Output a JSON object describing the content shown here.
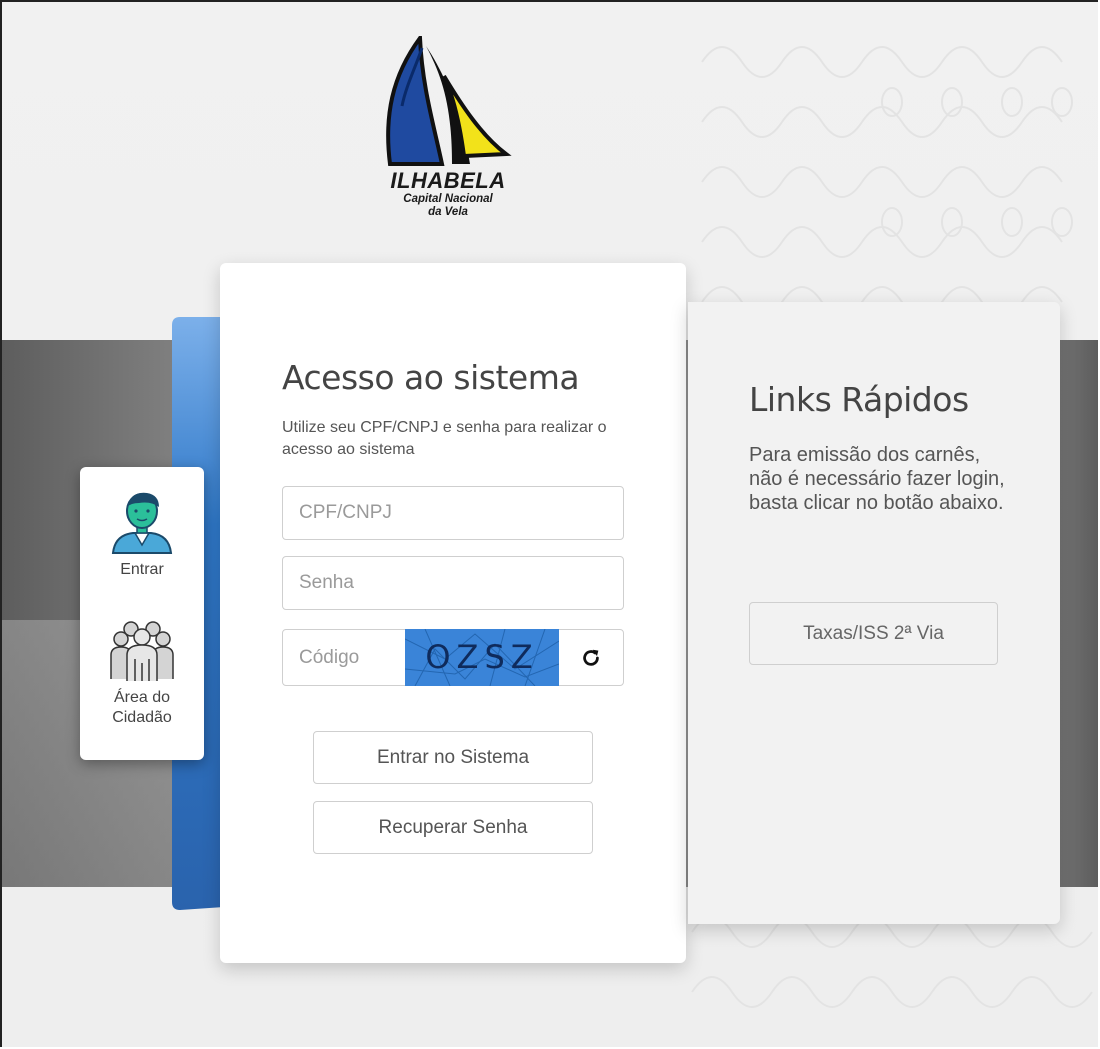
{
  "brand": {
    "logo_title": "ILHABELA",
    "logo_subtitle_line1": "Capital Nacional",
    "logo_subtitle_line2": "da Vela",
    "logo_icon": "sailboat-logo"
  },
  "side_menu": {
    "items": [
      {
        "label": "Entrar",
        "icon": "user-icon"
      },
      {
        "label_line1": "Área do",
        "label_line2": "Cidadão",
        "icon": "citizens-group-icon"
      }
    ]
  },
  "login": {
    "title": "Acesso ao sistema",
    "description": "Utilize seu CPF/CNPJ e senha para realizar o acesso ao sistema",
    "cpf_placeholder": "CPF/CNPJ",
    "senha_placeholder": "Senha",
    "codigo_placeholder": "Código",
    "captcha_text": "OZSZ",
    "refresh_icon": "refresh-icon",
    "submit_label": "Entrar no Sistema",
    "recover_label": "Recuperar Senha"
  },
  "quick_links": {
    "title": "Links Rápidos",
    "description": "Para emissão dos carnês, não é necessário fazer login, basta clicar no botão abaixo.",
    "button_label": "Taxas/ISS 2ª Via"
  },
  "colors": {
    "primary_blue": "#2f78c8",
    "captcha_bg": "#3a84d8",
    "logo_blue": "#1f4aa0",
    "logo_yellow": "#f2e21a",
    "avatar_green": "#2bbf9a"
  }
}
